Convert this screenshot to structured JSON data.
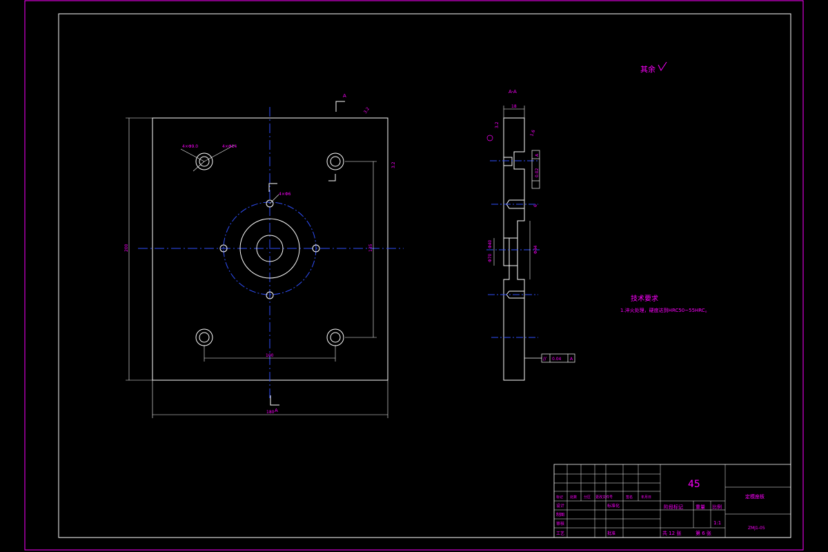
{
  "front_view": {
    "section_marker": "A",
    "section_marker_bottom": "A",
    "dims": {
      "width": "180",
      "height": "200",
      "hole_spacing_h": "100",
      "hole_spacing_v": "135",
      "counterbore_1": "4×Φ9.0",
      "counterbore_2": "4×Φ14",
      "center_holes": "4×Φ6",
      "roughness_corner": "3.2",
      "roughness_side": "3.2"
    }
  },
  "section_view": {
    "title": "A-A",
    "thickness": "18",
    "roughness_1": "3.2",
    "roughness_2": "1.6",
    "label_left_1": "Φ40",
    "label_left_2": "Φ70",
    "label_right": "Φ44",
    "tol_1": "0.02",
    "tol_datum_1": "A",
    "tol_2": "0.04",
    "tol_datum_2": "A",
    "depth": "6"
  },
  "surface_note": "其余",
  "tech_req": {
    "title": "技术要求",
    "item_1": "1.淬火处理，硬度达到HRC50~55HRC。"
  },
  "title_block": {
    "material": "45",
    "part_name": "定模座板",
    "drawing_no": "ZMJ1-05",
    "scale_label": "比例",
    "weight_label": "重量",
    "stage_label": "阶段标记",
    "scale": "1:1",
    "row_labels": [
      "标记",
      "处数",
      "分区",
      "更改文件号",
      "签名",
      "年月日"
    ],
    "design": "设计",
    "standard": "标准化",
    "drafting": "制图",
    "review": "审核",
    "process": "工艺",
    "approve": "批准",
    "total_sheets": "共 12 张",
    "sheet_no": "第 6 张"
  }
}
